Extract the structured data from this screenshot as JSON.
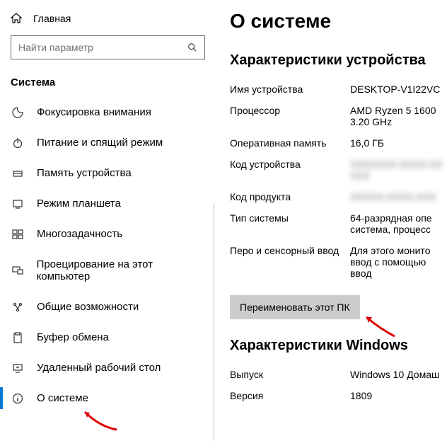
{
  "header": {
    "home_label": "Главная"
  },
  "search": {
    "placeholder": "Найти параметр"
  },
  "section_title": "Система",
  "nav": {
    "items": [
      {
        "label": "Фокусировка внимания",
        "icon": "moon-icon"
      },
      {
        "label": "Питание и спящий режим",
        "icon": "power-icon"
      },
      {
        "label": "Память устройства",
        "icon": "storage-icon"
      },
      {
        "label": "Режим планшета",
        "icon": "tablet-icon"
      },
      {
        "label": "Многозадачность",
        "icon": "multitask-icon"
      },
      {
        "label": "Проецирование на этот компьютер",
        "icon": "project-icon"
      },
      {
        "label": "Общие возможности",
        "icon": "shared-icon"
      },
      {
        "label": "Буфер обмена",
        "icon": "clipboard-icon"
      },
      {
        "label": "Удаленный рабочий стол",
        "icon": "remote-icon"
      },
      {
        "label": "О системе",
        "icon": "info-icon"
      }
    ]
  },
  "page": {
    "title": "О системе",
    "device_heading": "Характеристики устройства",
    "device": {
      "name_label": "Имя устройства",
      "name_value": "DESKTOP-V1I22VC",
      "cpu_label": "Процессор",
      "cpu_value": "AMD Ryzen 5 1600 3.20 GHz",
      "ram_label": "Оперативная память",
      "ram_value": "16,0 ГБ",
      "deviceid_label": "Код устройства",
      "deviceid_value": "XXXXXXX-XXXX-XX  XXX",
      "productid_label": "Код продукта",
      "productid_value": "XXXXX-XXXX-XXX",
      "systype_label": "Тип системы",
      "systype_value": "64-разрядная опе система, процесс",
      "pen_label": "Перо и сенсорный ввод",
      "pen_value": "Для этого монито ввод с помощью ввод"
    },
    "rename_button": "Переименовать этот ПК",
    "windows_heading": "Характеристики Windows",
    "windows": {
      "edition_label": "Выпуск",
      "edition_value": "Windows 10 Домаш",
      "version_label": "Версия",
      "version_value": "1809"
    }
  }
}
